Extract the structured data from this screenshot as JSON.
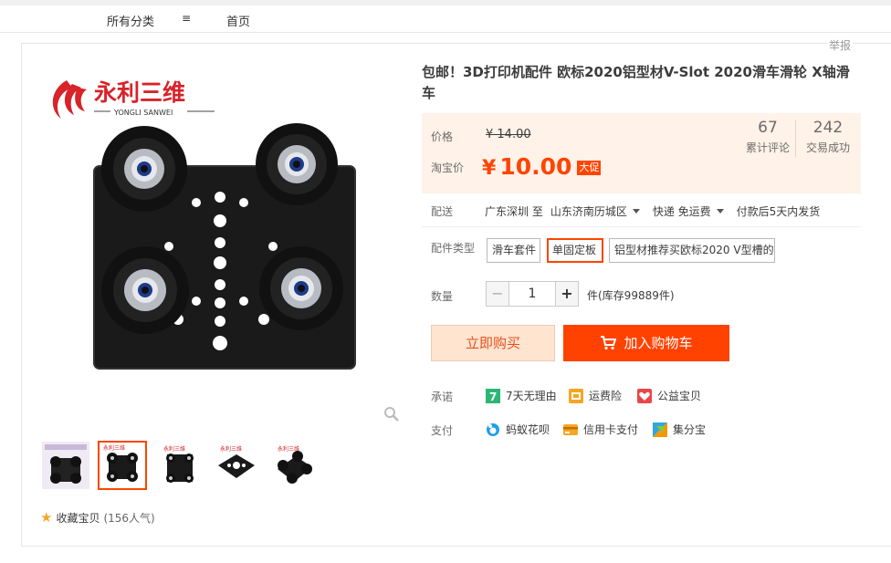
{
  "nav": {
    "all_categories": "所有分类",
    "menu_glyph": "≡",
    "home": "首页"
  },
  "report": "举报",
  "brand": {
    "name_cn": "永利三维",
    "name_en": "YONGLI SANWEI"
  },
  "title": "包邮！3D打印机配件 欧标2020铝型材V-Slot 2020滑车滑轮 X轴滑车",
  "price": {
    "label": "价格",
    "original": "¥ 14.00",
    "promo_label": "淘宝价",
    "currency": "¥",
    "promo": "10.00",
    "promo_badge": "大促"
  },
  "stats": [
    {
      "value": "67",
      "label": "累计评论"
    },
    {
      "value": "242",
      "label": "交易成功"
    }
  ],
  "shipping": {
    "label": "配送",
    "from": "广东深圳 至",
    "to": "山东济南历城区",
    "method": "快递 免运费",
    "delivery": "付款后5天内发货"
  },
  "options": {
    "label": "配件类型",
    "items": [
      "滑车套件",
      "单固定板",
      "铝型材推荐买欧标2020 V型槽的"
    ],
    "selected_index": 1
  },
  "quantity": {
    "label": "数量",
    "value": "1",
    "stock": "件(库存99889件)"
  },
  "buttons": {
    "buy_now": "立即购买",
    "add_to_cart": "加入购物车"
  },
  "promise": {
    "label": "承诺",
    "items": [
      {
        "icon": "seven-day-icon",
        "text": "7天无理由"
      },
      {
        "icon": "freight-insurance-icon",
        "text": "运费险"
      },
      {
        "icon": "charity-icon",
        "text": "公益宝贝"
      }
    ]
  },
  "payment": {
    "label": "支付",
    "items": [
      {
        "icon": "huabei-icon",
        "text": "蚂蚁花呗"
      },
      {
        "icon": "credit-card-icon",
        "text": "信用卡支付"
      },
      {
        "icon": "jifenbao-icon",
        "text": "集分宝"
      }
    ]
  },
  "favorite": {
    "label": "收藏宝贝",
    "count": "(156人气)"
  },
  "colors": {
    "accent": "#ff4400",
    "price_bg": "#fff2e8",
    "buy_now_bg": "#ffe4d0"
  }
}
